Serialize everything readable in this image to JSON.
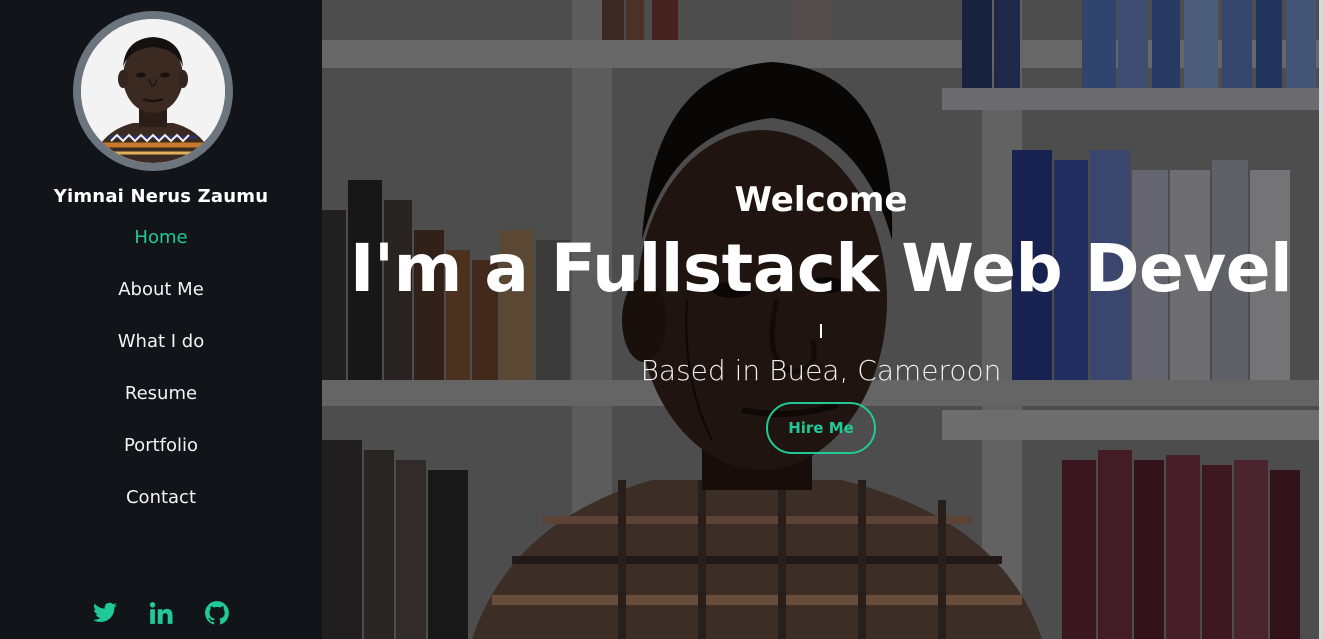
{
  "profile": {
    "name": "Yimnai Nerus Zaumu"
  },
  "nav": {
    "items": [
      {
        "label": "Home",
        "active": true
      },
      {
        "label": "About Me"
      },
      {
        "label": "What I do"
      },
      {
        "label": "Resume"
      },
      {
        "label": "Portfolio"
      },
      {
        "label": "Contact"
      }
    ]
  },
  "socials": {
    "items": [
      "twitter-icon",
      "linkedin-icon",
      "github-icon"
    ]
  },
  "hero": {
    "welcome": "Welcome",
    "headline": "I'm a Fullstack Web Devel",
    "subtitle": "Based in Buea, Cameroon",
    "cta_label": "Hire Me"
  },
  "colors": {
    "accent": "#20c997",
    "sidebar_bg": "#111418",
    "avatar_border": "#6c757d"
  }
}
